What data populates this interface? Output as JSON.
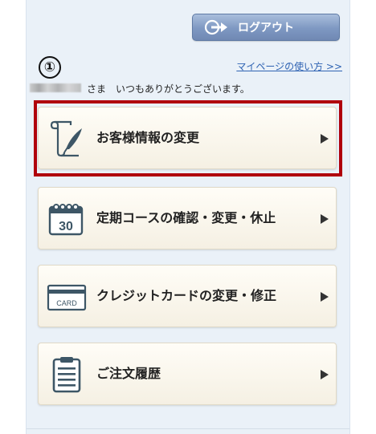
{
  "header": {
    "logout_label": "ログアウト",
    "usage_link": "マイページの使い方 >>",
    "step_badge": "①"
  },
  "greeting": {
    "text": "さま　いつもありがとうございます。"
  },
  "menu": {
    "items": [
      {
        "label": "お客様情報の変更",
        "icon": "pen-document-icon"
      },
      {
        "label": "定期コースの確認・変更・休止",
        "icon": "calendar-icon",
        "icon_text": "30"
      },
      {
        "label": "クレジットカードの変更・修正",
        "icon": "credit-card-icon",
        "icon_text": "CARD"
      },
      {
        "label": "ご注文履歴",
        "icon": "clipboard-icon"
      }
    ]
  },
  "colors": {
    "panel_bg": "#eaf1f8",
    "button_blue": "#7e98c2",
    "highlight_red": "#b0000c",
    "link_blue": "#2f63b3",
    "card_bg": "#fbf8ee"
  }
}
